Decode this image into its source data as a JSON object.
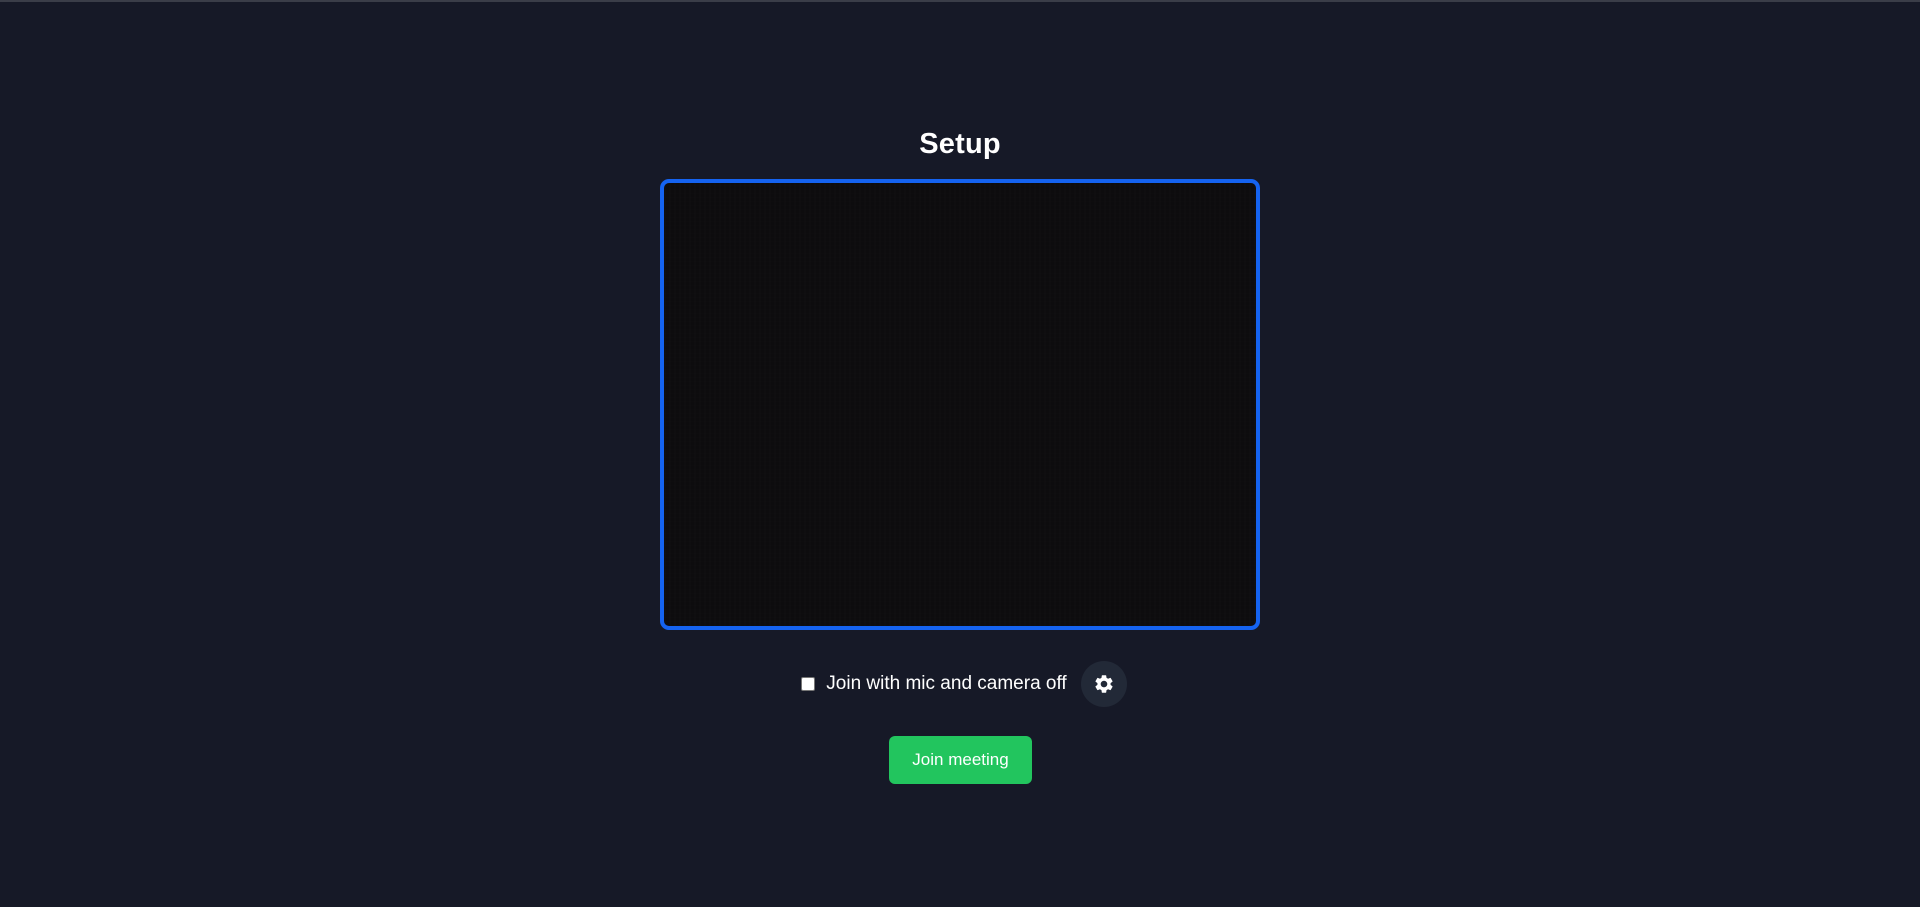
{
  "page": {
    "title": "Setup"
  },
  "preview": {
    "border_color": "#1563f0",
    "background_color": "#0d0c0e"
  },
  "controls": {
    "mute_checkbox_label": "Join with mic and camera off",
    "mute_checkbox_checked": false,
    "settings_icon": "gear-icon"
  },
  "actions": {
    "join_label": "Join meeting",
    "join_color": "#22c55e"
  },
  "theme": {
    "background": "#161927",
    "settings_button_bg": "#222937"
  }
}
